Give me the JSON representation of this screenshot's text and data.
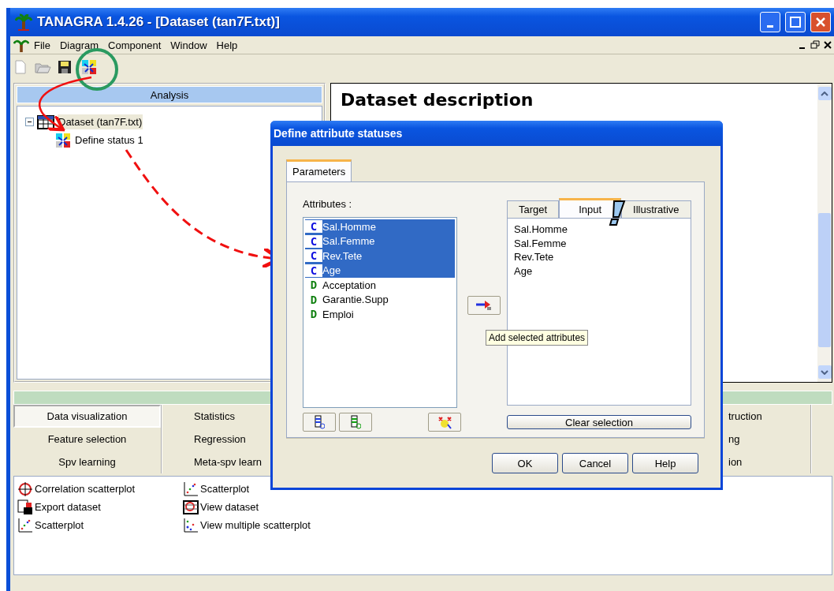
{
  "window": {
    "title": "TANAGRA 1.4.26 - [Dataset (tan7F.txt)]"
  },
  "menu": [
    {
      "label": "File"
    },
    {
      "label": "Diagram"
    },
    {
      "label": "Component"
    },
    {
      "label": "Window"
    },
    {
      "label": "Help"
    }
  ],
  "analysis": {
    "header": "Analysis",
    "tree": [
      {
        "label": "Dataset (tan7F.txt)",
        "expanded": true,
        "selected": true,
        "children": [
          {
            "label": "Define status 1",
            "selected": false
          }
        ]
      }
    ]
  },
  "report": {
    "heading": "Dataset description"
  },
  "component_tabs": {
    "left": [
      {
        "label": "Data visualization",
        "selected": true
      },
      {
        "label": "Feature selection",
        "selected": false
      },
      {
        "label": "Spv learning",
        "selected": false
      }
    ],
    "middle": [
      {
        "label": "Statistics",
        "selected": false
      },
      {
        "label": "Regression",
        "selected": false
      },
      {
        "label": "Meta-spv learn",
        "selected": false
      }
    ],
    "right": [
      {
        "label": "truction",
        "selected": false
      },
      {
        "label": "ng",
        "selected": false
      },
      {
        "label": "ion",
        "selected": false
      }
    ]
  },
  "components": [
    {
      "label": "Correlation scatterplot",
      "kind": "crosshair"
    },
    {
      "label": "Export dataset",
      "kind": "export"
    },
    {
      "label": "Scatterplot",
      "kind": "scatter"
    },
    {
      "label": "Scatterplot",
      "kind": "scatter"
    },
    {
      "label": "View dataset",
      "kind": "grid"
    },
    {
      "label": "View multiple scatterplot",
      "kind": "multi"
    }
  ],
  "dialog": {
    "title": "Define attribute statuses",
    "tabs": [
      {
        "label": "Parameters",
        "selected": true
      }
    ],
    "attributes_label": "Attributes :",
    "attributes": [
      {
        "type": "C",
        "name": "Sal.Homme",
        "selected": true
      },
      {
        "type": "C",
        "name": "Sal.Femme",
        "selected": true
      },
      {
        "type": "C",
        "name": "Rev.Tete",
        "selected": true
      },
      {
        "type": "C",
        "name": "Age",
        "selected": true
      },
      {
        "type": "D",
        "name": "Acceptation",
        "selected": false
      },
      {
        "type": "D",
        "name": "Garantie.Supp",
        "selected": false
      },
      {
        "type": "D",
        "name": "Emploi",
        "selected": false
      }
    ],
    "tooltip": "Add selected attributes",
    "status_tabs": [
      {
        "label": "Target",
        "selected": false
      },
      {
        "label": "Input",
        "selected": true
      },
      {
        "label": "Illustrative",
        "selected": false
      }
    ],
    "input_list": [
      "Sal.Homme",
      "Sal.Femme",
      "Rev.Tete",
      "Age"
    ],
    "clear_button": "Clear selection",
    "buttons": [
      "OK",
      "Cancel",
      "Help"
    ]
  }
}
